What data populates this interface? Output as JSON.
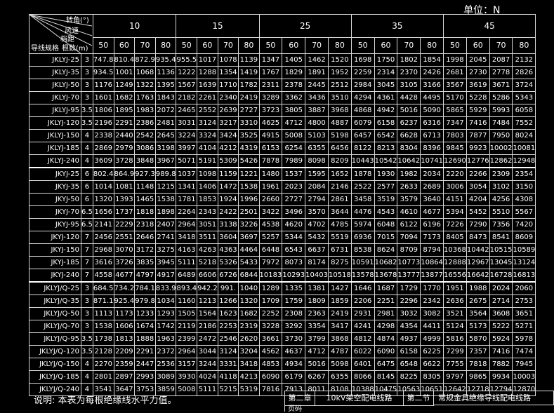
{
  "unit_label": "单位：N",
  "header": {
    "corner_labels": {
      "angle": "转角(°)",
      "wind": "风速",
      "span": "档距",
      "size": "导线规格",
      "bundle": "根数(m)"
    },
    "angles": [
      "10",
      "15",
      "25",
      "35",
      "45"
    ],
    "speeds": [
      "50",
      "60",
      "70",
      "80"
    ]
  },
  "rows": [
    {
      "model": "JKLYJ-25",
      "n": "3",
      "vals": [
        "747.8",
        "810.4",
        "872.9",
        "935.4",
        "955.5",
        "1017",
        "1078",
        "1139",
        "1347",
        "1405",
        "1462",
        "1520",
        "1698",
        "1750",
        "1802",
        "1854",
        "1998",
        "2045",
        "2087",
        "2132"
      ]
    },
    {
      "model": "JKLYJ-35",
      "n": "3",
      "vals": [
        "934.5",
        "1001",
        "1068",
        "1136",
        "1222",
        "1288",
        "1354",
        "1419",
        "1767",
        "1829",
        "1891",
        "1952",
        "2259",
        "2314",
        "2370",
        "2426",
        "2681",
        "2730",
        "2778",
        "2826"
      ]
    },
    {
      "model": "JKLYJ-50",
      "n": "3",
      "vals": [
        "1176",
        "1249",
        "1322",
        "1395",
        "1567",
        "1639",
        "1710",
        "1782",
        "2311",
        "2378",
        "2445",
        "2512",
        "2984",
        "3045",
        "3105",
        "3166",
        "3567",
        "3619",
        "3671",
        "3724"
      ]
    },
    {
      "model": "JKLYJ-70",
      "n": "3",
      "vals": [
        "1601",
        "1682",
        "1763",
        "1843",
        "2182",
        "2261",
        "2340",
        "2419",
        "3289",
        "3362",
        "3436",
        "3510",
        "4294",
        "4361",
        "4428",
        "4495",
        "5170",
        "5228",
        "5286",
        "5343"
      ]
    },
    {
      "model": "JKLYJ-95",
      "n": "3.5",
      "vals": [
        "1806",
        "1895",
        "1983",
        "2072",
        "2465",
        "2552",
        "2639",
        "2727",
        "3723",
        "3805",
        "3887",
        "3968",
        "4868",
        "4942",
        "5016",
        "5090",
        "5865",
        "5929",
        "5993",
        "6058"
      ]
    },
    {
      "model": "JKLYJ-120",
      "n": "3.5",
      "vals": [
        "2196",
        "2291",
        "2386",
        "2481",
        "3031",
        "3124",
        "3217",
        "3310",
        "4625",
        "4712",
        "4800",
        "4887",
        "6079",
        "6158",
        "6237",
        "6316",
        "7347",
        "7416",
        "7484",
        "7552"
      ]
    },
    {
      "model": "JKLYJ-150",
      "n": "4",
      "vals": [
        "2338",
        "2440",
        "2542",
        "2645",
        "3224",
        "3324",
        "3424",
        "3525",
        "4915",
        "5008",
        "5103",
        "5198",
        "6457",
        "6542",
        "6628",
        "6713",
        "7803",
        "7877",
        "7950",
        "8024"
      ]
    },
    {
      "model": "JKLYJ-185",
      "n": "4",
      "vals": [
        "2869",
        "2979",
        "3086",
        "3198",
        "3997",
        "4104",
        "4212",
        "4319",
        "6153",
        "6254",
        "6355",
        "6456",
        "8122",
        "8213",
        "8304",
        "8396",
        "9845",
        "9923",
        "10002",
        "10081"
      ]
    },
    {
      "model": "JKLYJ-240",
      "n": "4",
      "vals": [
        "3609",
        "3728",
        "3848",
        "3967",
        "5071",
        "5191",
        "5309",
        "5426",
        "7878",
        "7989",
        "8098",
        "8209",
        "10443",
        "10542",
        "10642",
        "10741",
        "12690",
        "12776",
        "12862",
        "12948"
      ]
    },
    {
      "model": "JKYJ-25",
      "n": "6",
      "vals": [
        "802.4",
        "864.9",
        "927.3",
        "989.8",
        "1037",
        "1098",
        "1159",
        "1221",
        "1480",
        "1537",
        "1595",
        "1652",
        "1878",
        "1930",
        "1982",
        "2034",
        "2220",
        "2266",
        "2309",
        "2354"
      ]
    },
    {
      "model": "JKYJ-35",
      "n": "6",
      "vals": [
        "1014",
        "1081",
        "1148",
        "1215",
        "1341",
        "1406",
        "1472",
        "1538",
        "1961",
        "2023",
        "2084",
        "2146",
        "2522",
        "2577",
        "2633",
        "2689",
        "3006",
        "3054",
        "3102",
        "3150"
      ]
    },
    {
      "model": "JKYJ-50",
      "n": "6",
      "vals": [
        "1320",
        "1393",
        "1465",
        "1538",
        "1781",
        "1853",
        "1924",
        "1996",
        "2660",
        "2727",
        "2794",
        "2861",
        "3458",
        "3519",
        "3579",
        "3640",
        "4151",
        "4204",
        "4256",
        "4308"
      ]
    },
    {
      "model": "JKYJ-70",
      "n": "6.5",
      "vals": [
        "1656",
        "1737",
        "1818",
        "1898",
        "2264",
        "2343",
        "2422",
        "2501",
        "3422",
        "3496",
        "3570",
        "3644",
        "4476",
        "4543",
        "4610",
        "4677",
        "5394",
        "5452",
        "5510",
        "5567"
      ]
    },
    {
      "model": "JKYJ-95",
      "n": "6.5",
      "vals": [
        "2141",
        "2229",
        "2318",
        "2407",
        "2964",
        "3051",
        "3138",
        "3226",
        "4538",
        "4620",
        "4702",
        "4785",
        "5974",
        "6048",
        "6122",
        "6196",
        "7226",
        "7290",
        "7356",
        "7420"
      ]
    },
    {
      "model": "JKYJ-120",
      "n": "7",
      "vals": [
        "2456",
        "2551",
        "2646",
        "2741",
        "3418",
        "3511",
        "3604",
        "3697",
        "5257",
        "5344",
        "5432",
        "5519",
        "6936",
        "7015",
        "7094",
        "7173",
        "8405",
        "8473",
        "8541",
        "8609"
      ]
    },
    {
      "model": "JKYJ-150",
      "n": "7",
      "vals": [
        "2968",
        "3070",
        "3172",
        "3275",
        "4163",
        "4263",
        "4363",
        "4464",
        "6448",
        "6543",
        "6637",
        "6731",
        "8538",
        "8624",
        "8709",
        "8794",
        "10368",
        "10442",
        "10515",
        "10589"
      ]
    },
    {
      "model": "JKYJ-185",
      "n": "7",
      "vals": [
        "3616",
        "3726",
        "3835",
        "3945",
        "5111",
        "5218",
        "5326",
        "5433",
        "7972",
        "8073",
        "8174",
        "8275",
        "10591",
        "10682",
        "10773",
        "10864",
        "12888",
        "12967",
        "13045",
        "13124"
      ]
    },
    {
      "model": "JKYJ-240",
      "n": "7",
      "vals": [
        "4558",
        "4677",
        "4797",
        "4917",
        "6489",
        "6606",
        "6726",
        "6844",
        "10183",
        "10293",
        "10403",
        "10518",
        "13578",
        "13678",
        "13777",
        "13877",
        "16556",
        "16642",
        "16728",
        "16813"
      ]
    },
    {
      "model": "JKLYJ/Q-25",
      "n": "3",
      "vals": [
        "684.5",
        "734.2",
        "784.1",
        "833.9",
        "893.4",
        "942.2",
        "991.",
        "1040",
        "1289",
        "1335",
        "1381",
        "1427",
        "1646",
        "1687",
        "1729",
        "1770",
        "1951",
        "1988",
        "2024",
        "2060"
      ]
    },
    {
      "model": "JKLYJ/Q-35",
      "n": "3",
      "vals": [
        "871.1",
        "925.4",
        "979.8",
        "1034",
        "1160",
        "1213",
        "1266",
        "1320",
        "1709",
        "1759",
        "1809",
        "1859",
        "2206",
        "2251",
        "2296",
        "2342",
        "2636",
        "2675",
        "2714",
        "2753"
      ]
    },
    {
      "model": "JKLYJ/Q-50",
      "n": "3",
      "vals": [
        "1113",
        "1173",
        "1233",
        "1293",
        "1505",
        "1564",
        "1623",
        "1682",
        "2252",
        "2308",
        "2363",
        "2419",
        "2931",
        "2981",
        "3032",
        "3082",
        "3521",
        "3564",
        "3608",
        "3651"
      ]
    },
    {
      "model": "JKLYJ/Q-70",
      "n": "3",
      "vals": [
        "1538",
        "1606",
        "1674",
        "1742",
        "2119",
        "2186",
        "2253",
        "2319",
        "3228",
        "3292",
        "3354",
        "3417",
        "4241",
        "4298",
        "4354",
        "4411",
        "5124",
        "5173",
        "5222",
        "5271"
      ]
    },
    {
      "model": "JKLYJ/Q-95",
      "n": "3.5",
      "vals": [
        "1738",
        "1813",
        "1888",
        "1963",
        "2399",
        "2472",
        "2546",
        "2620",
        "3661",
        "3730",
        "3799",
        "3868",
        "4812",
        "4874",
        "4937",
        "4999",
        "5816",
        "5870",
        "5924",
        "5978"
      ]
    },
    {
      "model": "JKLYJ/Q-120",
      "n": "3.5",
      "vals": [
        "2128",
        "2209",
        "2291",
        "2372",
        "2964",
        "3044",
        "3124",
        "3204",
        "4562",
        "4637",
        "4712",
        "4787",
        "6022",
        "6090",
        "6158",
        "6225",
        "7299",
        "7357",
        "7416",
        "7474"
      ]
    },
    {
      "model": "JKLYJ/Q-150",
      "n": "4",
      "vals": [
        "2270",
        "2359",
        "2447",
        "2536",
        "3157",
        "3244",
        "3331",
        "3418",
        "4853",
        "4934",
        "5016",
        "5098",
        "6401",
        "6475",
        "6548",
        "6622",
        "7755",
        "7818",
        "7882",
        "7945"
      ]
    },
    {
      "model": "JKLYJ/Q-185",
      "n": "4",
      "vals": [
        "2801",
        "2897",
        "2993",
        "3089",
        "3930",
        "4024",
        "4118",
        "4213",
        "6090",
        "6179",
        "6267",
        "6355",
        "8066",
        "8145",
        "8225",
        "8305",
        "9797",
        "9865",
        "9934",
        "10003"
      ]
    },
    {
      "model": "JKLYJ/Q-240",
      "n": "4",
      "vals": [
        "3541",
        "3647",
        "3753",
        "3859",
        "5008",
        "5111",
        "5215",
        "5319",
        "7816",
        "7913",
        "8011",
        "8108",
        "10388",
        "10475",
        "10563",
        "10651",
        "12642",
        "12718",
        "12794",
        "12870"
      ]
    }
  ],
  "note": "说明: 本表为每根绝缘线水平力值。",
  "footer": {
    "chapter": "第二章",
    "chapter_title": "10kV架空配电线路",
    "section": "第二节",
    "section_title": "常规金具绝缘导线配电线路",
    "page_label": "页码"
  }
}
